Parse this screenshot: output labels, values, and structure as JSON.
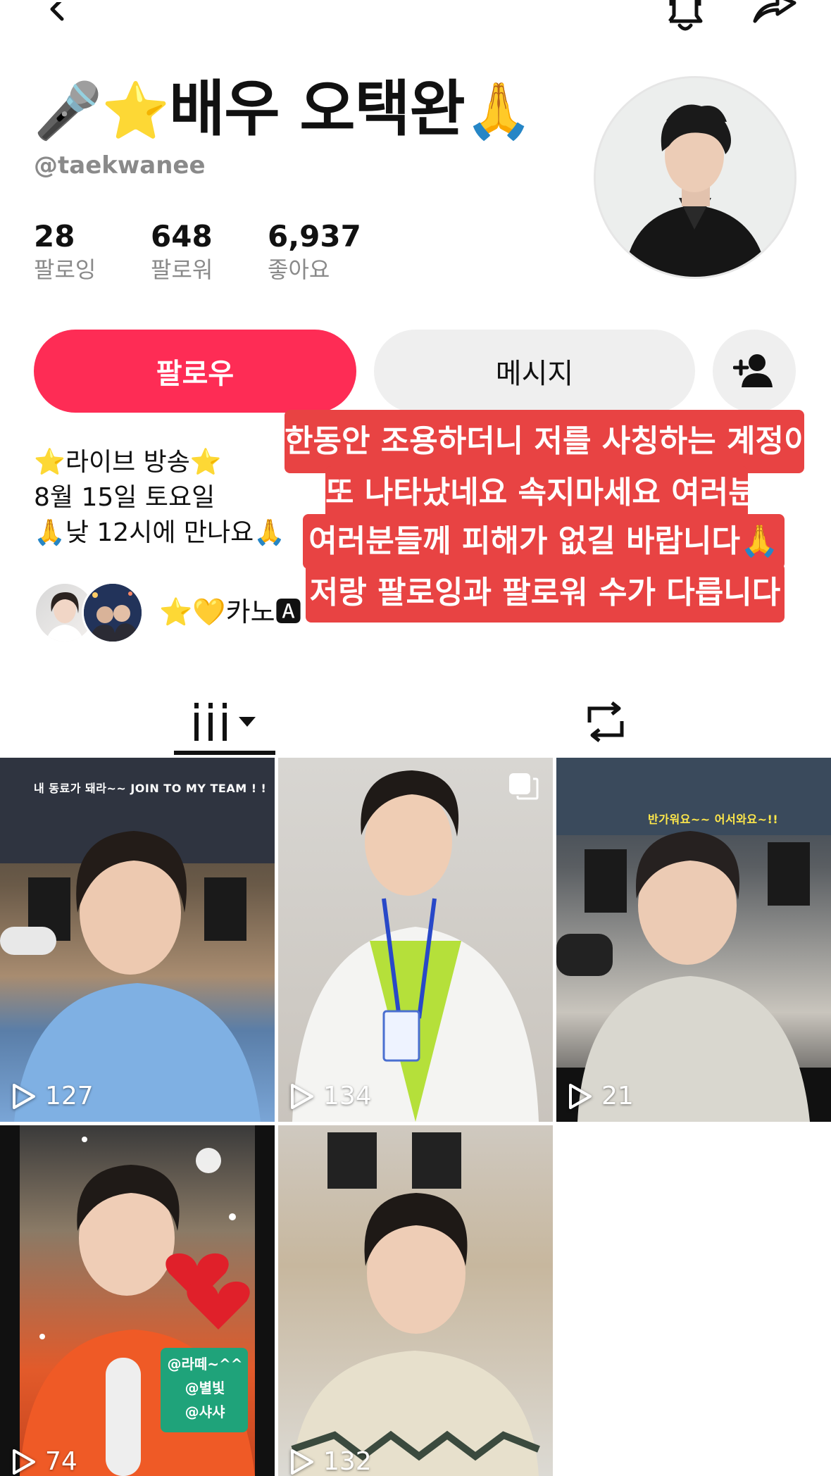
{
  "profile": {
    "display_name": "배우 오택완",
    "name_emoji_left": "🎤⭐",
    "name_emoji_right": "🙏",
    "username": "@taekwanee",
    "stats": [
      {
        "value": "28",
        "label": "팔로잉"
      },
      {
        "value": "648",
        "label": "팔로워"
      },
      {
        "value": "6,937",
        "label": "좋아요"
      }
    ]
  },
  "actions": {
    "follow_label": "팔로우",
    "message_label": "메시지"
  },
  "bio": {
    "lines": [
      "⭐라이브 방송⭐",
      "8월 15일 토요일",
      "🙏낮 12시에 만나요🙏"
    ]
  },
  "notice": {
    "lines": [
      "한동안 조용하더니 저를 사칭하는 계정이",
      "또 나타났네요 속지마세요 여러분",
      "여러분들께 피해가 없길 바랍니다🙏",
      "저랑 팔로잉과 팔로워 수가 다릅니다"
    ]
  },
  "friends": {
    "text": "⭐💛카노🅰"
  },
  "videos": [
    {
      "views": "127",
      "caption": "내 동료가 돼라~~ JOIN TO MY TEAM ! !"
    },
    {
      "views": "134",
      "caption": ""
    },
    {
      "views": "21",
      "caption": "반가워요~~ 어서와요~!!"
    },
    {
      "views": "74",
      "caption": ""
    },
    {
      "views": "132",
      "caption": ""
    }
  ],
  "tile4_tags": [
    "@라떼~^^",
    "@별빛",
    "@샤샤"
  ],
  "colors": {
    "accent": "#fe2c55",
    "notice_bg": "#e84343",
    "secondary_text": "#8a8a8a"
  },
  "icons": {
    "back": "chevron-left-icon",
    "bell": "bell-icon",
    "share": "share-icon",
    "add_friend": "person-add-icon",
    "videos_tab": "grid-columns-icon",
    "reposts_tab": "repost-icon",
    "play": "play-icon",
    "multi": "multi-photo-icon"
  }
}
